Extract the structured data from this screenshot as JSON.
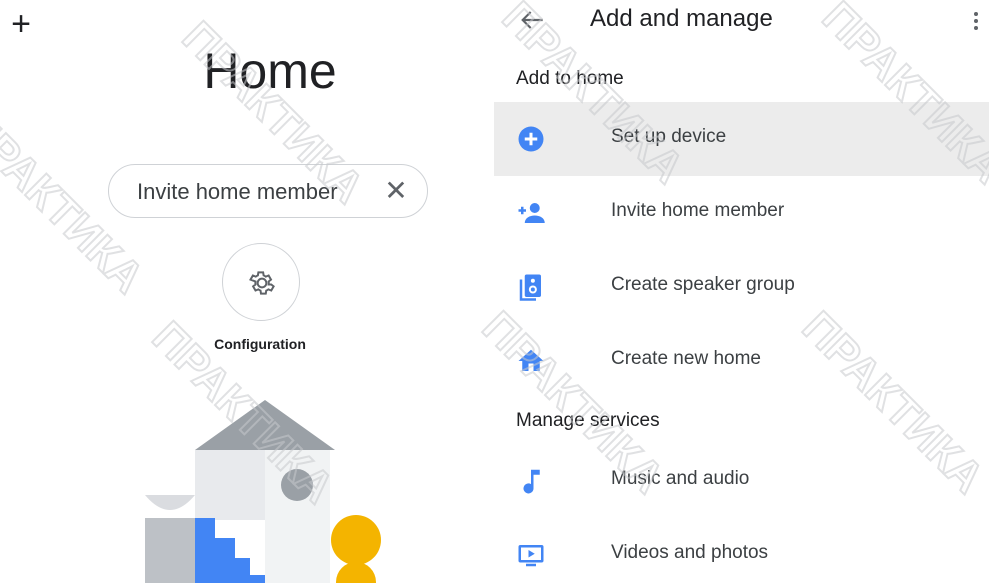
{
  "left": {
    "add_icon": "plus-icon",
    "title": "Home",
    "chip": {
      "label": "Invite home member",
      "close_icon": "close-icon"
    },
    "config": {
      "icon": "gear-icon",
      "label": "Configuration"
    }
  },
  "right": {
    "header": {
      "back_icon": "arrow-back-icon",
      "title": "Add and manage",
      "more_icon": "more-vert-icon"
    },
    "sections": [
      {
        "title": "Add to home",
        "items": [
          {
            "label": "Set up device",
            "icon": "add-circle-icon",
            "active": true
          },
          {
            "label": "Invite home member",
            "icon": "person-add-icon"
          },
          {
            "label": "Create speaker group",
            "icon": "speaker-group-icon"
          },
          {
            "label": "Create new home",
            "icon": "home-icon"
          }
        ]
      },
      {
        "title": "Manage services",
        "items": [
          {
            "label": "Music and audio",
            "icon": "music-note-icon"
          },
          {
            "label": "Videos and photos",
            "icon": "video-icon"
          }
        ]
      }
    ]
  },
  "watermark": "ПРАКТИКА",
  "colors": {
    "accent": "#4285f4",
    "yellow": "#f4b400",
    "text": "#202124",
    "active_row": "#ececec"
  }
}
